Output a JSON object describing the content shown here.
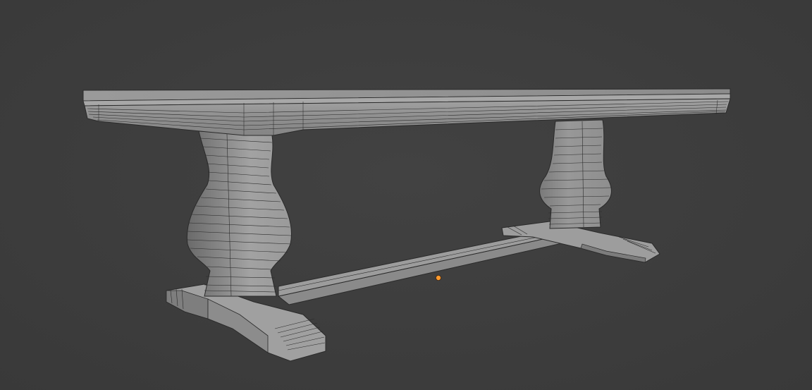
{
  "viewport": {
    "background_color": "#3d3d3d",
    "mesh_color": "#8e8e8e",
    "mesh_light_color": "#a6a6a6",
    "mesh_dark_color": "#6f6f6f",
    "wire_color": "#2a2a2a",
    "origin_color": "#ff9a2e"
  },
  "scene": {
    "object": "trestle-table-mesh",
    "shading": "solid-wireframe-overlay",
    "origin_marker": "object-origin-dot"
  }
}
